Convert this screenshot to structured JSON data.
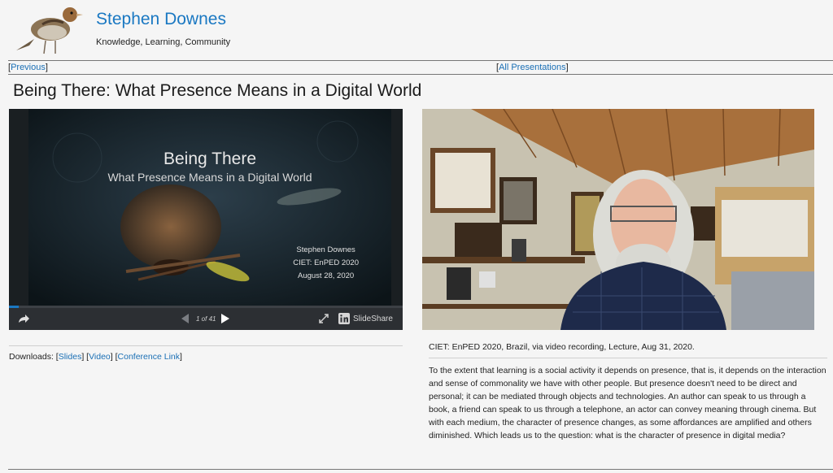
{
  "site": {
    "title": "Stephen Downes",
    "tagline": "Knowledge, Learning, Community"
  },
  "nav": {
    "previous": "Previous",
    "all_presentations": "All Presentations"
  },
  "presentation": {
    "title": "Being There: What Presence Means in a Digital World"
  },
  "slide": {
    "title": "Being There",
    "subtitle": "What Presence Means in a Digital World",
    "author": "Stephen Downes",
    "event": "CIET: EnPED 2020",
    "date": "August 28, 2020"
  },
  "player": {
    "counter": "1 of 41",
    "brand": "SlideShare",
    "progress": 0.0244,
    "icons": [
      "share-icon",
      "prev-icon",
      "next-icon",
      "expand-icon",
      "linkedin-icon"
    ]
  },
  "downloads": {
    "label": "Downloads:",
    "slides": "Slides",
    "video": "Video",
    "conference_link": "Conference Link"
  },
  "citation": "CIET: EnPED 2020, Brazil, via video recording, Lecture, Aug 31, 2020.",
  "abstract": "To the extent that learning is a social activity it depends on presence, that is, it depends on the interaction and sense of commonality we have with other people. But presence doesn't need to be direct and personal; it can be mediated through objects and technologies. An author can speak to us through a book, a friend can speak to us through a telephone, an actor can convey meaning through cinema. But with each medium, the character of presence changes, as some affordances are amplified and others diminished. Which leads us to the question: what is the character of presence in digital media?",
  "colors": {
    "link": "#1a6fb5",
    "site_title": "#1a78c2",
    "player_bar": "#2c2f33"
  }
}
